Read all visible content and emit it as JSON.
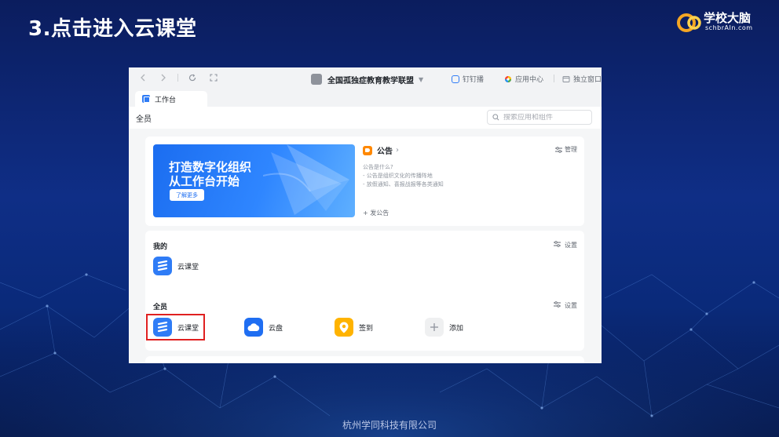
{
  "slide": {
    "title": "3.点击进入云课堂",
    "footer": "杭州学同科技有限公司",
    "brand_name": "学校大脑",
    "brand_sub": "schbrAIn.com"
  },
  "toolbar": {
    "back_icon": "chevron-left-icon",
    "forward_icon": "chevron-right-icon",
    "org_name": "全国孤独症教育教学联盟",
    "ding_label": "钉钉播",
    "app_center_label": "应用中心",
    "standalone_label": "独立窗口"
  },
  "tab": {
    "label": "工作台"
  },
  "header": {
    "scope": "全员",
    "search_placeholder": "搜索应用和组件"
  },
  "banner": {
    "line1": "打造数字化组织",
    "line2": "从工作台开始",
    "button": "了解更多"
  },
  "notice": {
    "title": "公告",
    "manage": "管理",
    "lines": [
      "公告是什么?",
      "- 公告是组织文化的传播阵地",
      "- 放假通知、喜报战报等各类通知"
    ],
    "post": "发公告"
  },
  "mine": {
    "title": "我的",
    "settings": "设置",
    "apps": [
      {
        "label": "云课堂",
        "icon": "cloud-classroom-icon"
      }
    ]
  },
  "all": {
    "title": "全员",
    "settings": "设置",
    "apps": [
      {
        "label": "云课堂",
        "icon": "cloud-classroom-icon"
      },
      {
        "label": "云盘",
        "icon": "cloud-drive-icon"
      },
      {
        "label": "签到",
        "icon": "check-in-icon"
      },
      {
        "label": "添加",
        "icon": "plus-icon"
      }
    ]
  },
  "colors": {
    "accent": "#2f7cf6",
    "highlight": "#e02020",
    "notice_orange": "#ff8800",
    "checkin_yellow": "#ffb300"
  }
}
